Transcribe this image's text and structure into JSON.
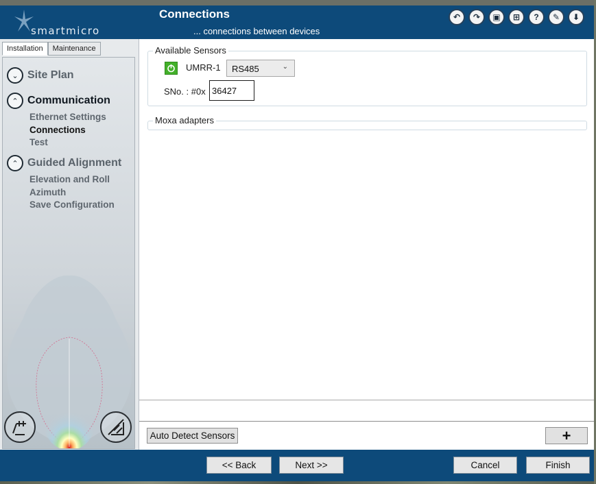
{
  "header": {
    "logo_text": "smartmicro",
    "title": "Connections",
    "subtitle": "... connections between devices",
    "toolbar": [
      {
        "name": "undo-icon",
        "glyph": "↶"
      },
      {
        "name": "redo-icon",
        "glyph": "↷"
      },
      {
        "name": "save-icon",
        "glyph": "▣"
      },
      {
        "name": "save-as-icon",
        "glyph": "⊞"
      },
      {
        "name": "help-icon",
        "glyph": "?"
      },
      {
        "name": "tag-icon",
        "glyph": "✎"
      },
      {
        "name": "download-icon",
        "glyph": "⬇"
      }
    ]
  },
  "sidebar": {
    "tabs": [
      "Installation",
      "Maintenance"
    ],
    "groups": [
      {
        "label": "Site Plan",
        "glyph": "⌄"
      },
      {
        "label": "Communication",
        "glyph": "⌃"
      },
      {
        "label": "Guided Alignment",
        "glyph": "⌃"
      }
    ],
    "communication_items": [
      "Ethernet Settings",
      "Connections",
      "Test"
    ],
    "alignment_items": [
      "Elevation and Roll",
      "Azimuth",
      "Save Configuration"
    ]
  },
  "main": {
    "available_sensors": {
      "title": "Available Sensors",
      "sensor_name": "UMRR-1",
      "interface": "RS485",
      "sno_label": "SNo. : #0x",
      "sno_value": "36427"
    },
    "moxa": {
      "title": "Moxa adapters"
    },
    "auto_detect_label": "Auto Detect Sensors",
    "add_label": "+"
  },
  "footer": {
    "back": "<<  Back",
    "next": "Next  >>",
    "cancel": "Cancel",
    "finish": "Finish"
  },
  "colors": {
    "header_bg": "#0d4a7a",
    "status_green": "#43b02a"
  }
}
